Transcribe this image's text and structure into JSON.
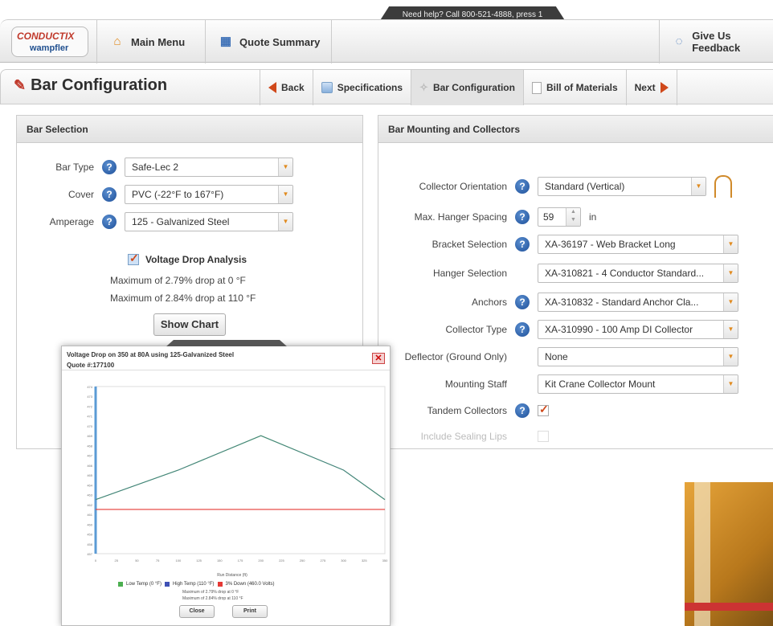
{
  "help_banner": "Need help? Call 800-521-4888, press 1",
  "brand": {
    "line1": "CONDUCTIX",
    "line2": "wampfler"
  },
  "topnav": {
    "main_menu": "Main Menu",
    "quote_summary": "Quote Summary",
    "feedback": "Give Us Feedback"
  },
  "page": {
    "title": "Bar Configuration"
  },
  "steps": {
    "back": "Back",
    "specifications": "Specifications",
    "bar_configuration": "Bar Configuration",
    "bill_of_materials": "Bill of Materials",
    "next": "Next"
  },
  "bar_selection": {
    "title": "Bar Selection",
    "bar_type": {
      "label": "Bar Type",
      "value": "Safe-Lec 2"
    },
    "cover": {
      "label": "Cover",
      "value": "PVC (-22°F to 167°F)"
    },
    "amperage": {
      "label": "Amperage",
      "value": "125 - Galvanized Steel"
    },
    "voltage_drop_label": "Voltage Drop Analysis",
    "drop_line1": "Maximum of 2.79% drop at 0 °F",
    "drop_line2": "Maximum of 2.84% drop at 110 °F",
    "show_chart": "Show Chart"
  },
  "mounting": {
    "title": "Bar Mounting and Collectors",
    "collector_orientation": {
      "label": "Collector Orientation",
      "value": "Standard (Vertical)"
    },
    "max_hanger_spacing": {
      "label": "Max. Hanger Spacing",
      "value": "59",
      "unit": "in"
    },
    "bracket_selection": {
      "label": "Bracket Selection",
      "value": "XA-36197 - Web Bracket Long"
    },
    "hanger_selection": {
      "label": "Hanger Selection",
      "value": "XA-310821 - 4 Conductor Standard..."
    },
    "anchors": {
      "label": "Anchors",
      "value": "XA-310832 - Standard Anchor Cla..."
    },
    "collector_type": {
      "label": "Collector Type",
      "value": "XA-310990 - 100 Amp DI Collector"
    },
    "deflector": {
      "label": "Deflector (Ground Only)",
      "value": "None"
    },
    "mounting_staff": {
      "label": "Mounting Staff",
      "value": "Kit Crane Collector Mount"
    },
    "tandem_collectors": {
      "label": "Tandem Collectors",
      "checked": true
    },
    "sealing_lips": {
      "label": "Include Sealing Lips",
      "checked": false
    }
  },
  "chart_modal": {
    "title": "Voltage Drop on 350 at 80A using 125-Galvanized Steel",
    "quote": "Quote #:177100",
    "xlabel": "Run Distance (ft)",
    "close_button": "Close",
    "print_button": "Print",
    "summary1": "Maximum of 2.79% drop at 0 °F",
    "summary2": "Maximum of 2.84% drop at 110 °F"
  },
  "chart_data": {
    "type": "line",
    "x": [
      0,
      100,
      200,
      300,
      350
    ],
    "series": [
      {
        "name": "Low Temp (0 °F)",
        "color": "#4caf50",
        "values": [
          462.5,
          465.5,
          469,
          465.5,
          462.5
        ]
      },
      {
        "name": "High Temp (110 °F)",
        "color": "#3f51b5",
        "values": [
          462.5,
          465.5,
          469,
          465.5,
          462.5
        ]
      },
      {
        "name": "3% Down (460.0 Volts)",
        "color": "#e53935",
        "values": [
          461.5,
          461.5,
          461.5,
          461.5,
          461.5
        ]
      }
    ],
    "xlim": [
      0,
      350
    ],
    "ylim": [
      457,
      474
    ],
    "grid": false,
    "legend": "bottom"
  },
  "colors": {
    "accent": "#d0491b",
    "help_blue": "#1d4f99"
  }
}
